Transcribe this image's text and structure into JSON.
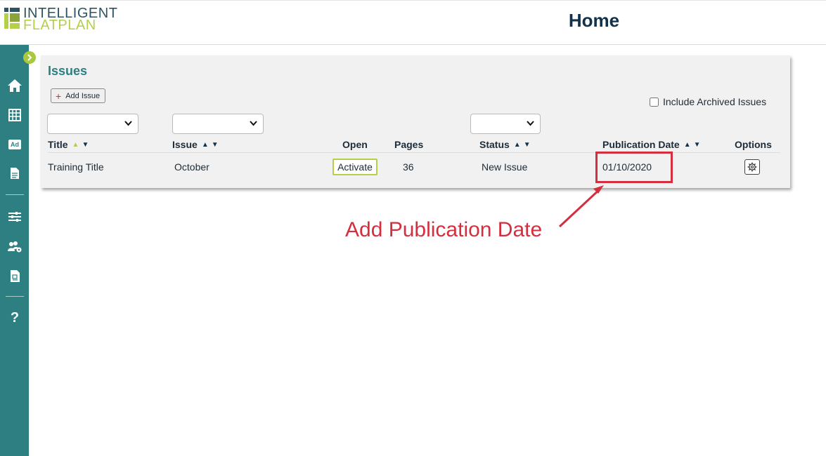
{
  "app": {
    "logo_line1": "INTELLIGENT",
    "logo_line2": "FLATPLAN",
    "page_title": "Home"
  },
  "sidebar": {
    "items": [
      {
        "icon": "home-icon"
      },
      {
        "icon": "grid-icon"
      },
      {
        "icon": "ad-icon",
        "label": "Ad"
      },
      {
        "icon": "document-icon"
      },
      {
        "icon": "sliders-icon"
      },
      {
        "icon": "users-gear-icon"
      },
      {
        "icon": "report-icon"
      },
      {
        "icon": "help-icon",
        "label": "?"
      }
    ]
  },
  "issues": {
    "title": "Issues",
    "add_label": "Add Issue",
    "include_archived_label": "Include Archived Issues",
    "include_archived_checked": false,
    "columns": {
      "title": "Title",
      "issue": "Issue",
      "open": "Open",
      "pages": "Pages",
      "status": "Status",
      "publication_date": "Publication Date",
      "options": "Options"
    },
    "rows": [
      {
        "title": "Training Title",
        "issue": "October",
        "open_action": "Activate",
        "pages": "36",
        "status": "New Issue",
        "publication_date": "01/10/2020"
      }
    ]
  },
  "annotation": {
    "text": "Add Publication Date",
    "color": "#d32f3f"
  },
  "colors": {
    "sidebar": "#2d7f82",
    "accent_green": "#b4cf4a",
    "logo_dark": "#2d5460",
    "title_navy": "#12314a"
  }
}
